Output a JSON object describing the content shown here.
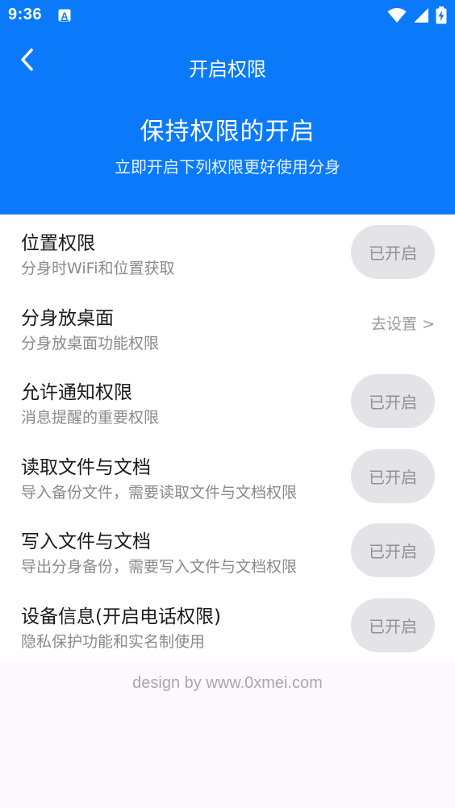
{
  "status_bar": {
    "time": "9:36",
    "notification_icon": "a-icon",
    "icons": [
      "wifi-icon",
      "signal-icon",
      "battery-charging-icon"
    ]
  },
  "nav": {
    "back_icon": "chevron-left-icon",
    "title": "开启权限"
  },
  "hero": {
    "title": "保持权限的开启",
    "subtitle": "立即开启下列权限更好使用分身"
  },
  "permissions": [
    {
      "title": "位置权限",
      "desc": "分身时WiFi和位置获取",
      "action": "已开启",
      "action_type": "button"
    },
    {
      "title": "分身放桌面",
      "desc": "分身放桌面功能权限",
      "action": "去设置 >",
      "action_type": "link"
    },
    {
      "title": "允许通知权限",
      "desc": "消息提醒的重要权限",
      "action": "已开启",
      "action_type": "button"
    },
    {
      "title": "读取文件与文档",
      "desc": "导入备份文件，需要读取文件与文档权限",
      "action": "已开启",
      "action_type": "button"
    },
    {
      "title": "写入文件与文档",
      "desc": "导出分身备份，需要写入文件与文档权限",
      "action": "已开启",
      "action_type": "button"
    },
    {
      "title": "设备信息(开启电话权限)",
      "desc": "隐私保护功能和实名制使用",
      "action": "已开启",
      "action_type": "button"
    }
  ],
  "footer": {
    "text": "design by www.0xmei.com"
  },
  "colors": {
    "primary": "#0a7afa",
    "page_background": "#fdf8fd",
    "button_background": "#e4e4e8",
    "button_text": "#8e8e93"
  }
}
